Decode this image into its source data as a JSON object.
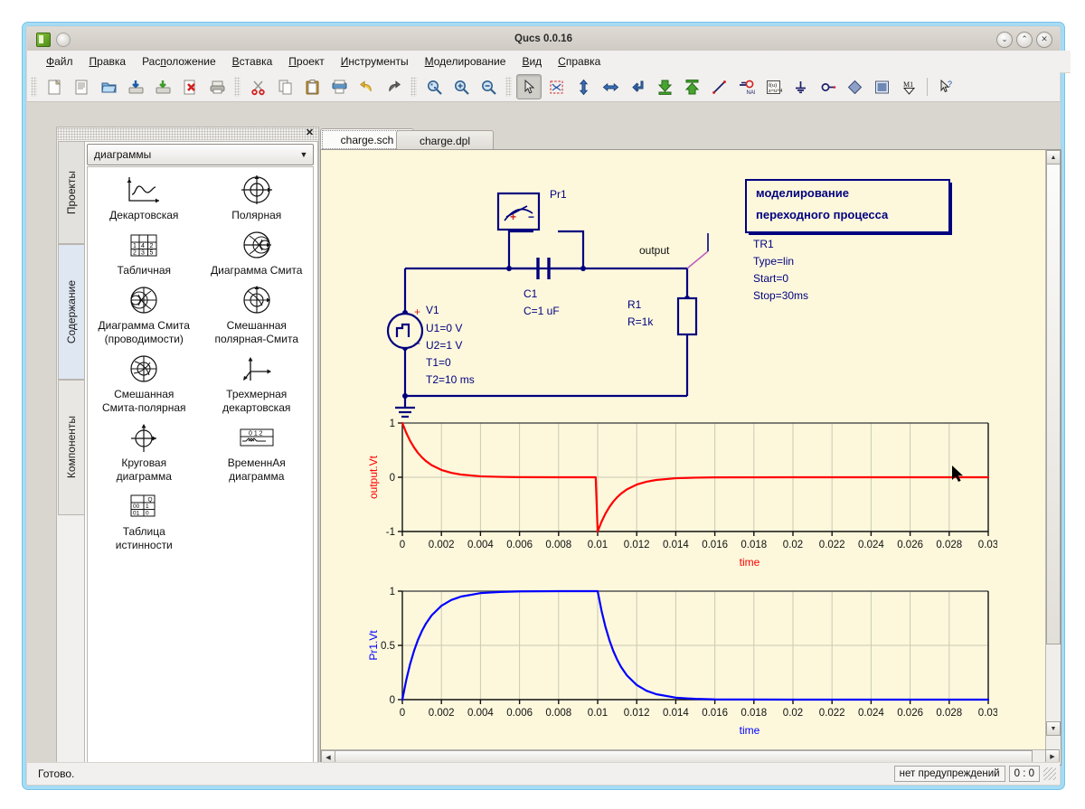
{
  "window": {
    "title": "Qucs 0.0.16",
    "buttons": {
      "minimize": "⌄",
      "maximize": "⌃",
      "close": "✕"
    }
  },
  "menubar": {
    "items": [
      {
        "name": "file",
        "label": "Файл",
        "accel": "Ф"
      },
      {
        "name": "edit",
        "label": "Правка",
        "accel": "П"
      },
      {
        "name": "layout",
        "label": "Расположение",
        "accel": "п"
      },
      {
        "name": "insert",
        "label": "Вставка",
        "accel": "В"
      },
      {
        "name": "project",
        "label": "Проект",
        "accel": "П"
      },
      {
        "name": "tools",
        "label": "Инструменты",
        "accel": "И"
      },
      {
        "name": "simulation",
        "label": "Моделирование",
        "accel": "М"
      },
      {
        "name": "view",
        "label": "Вид",
        "accel": "В"
      },
      {
        "name": "help",
        "label": "Справка",
        "accel": "С"
      }
    ]
  },
  "toolbar": {
    "groups": [
      [
        "new-document-icon",
        "new-text-icon",
        "open-folder-icon",
        "save-icon",
        "save-as-icon",
        "close-document-icon",
        "print-icon"
      ],
      [
        "cut-icon",
        "copy-icon",
        "paste-icon",
        "print-preview-icon",
        "undo-icon",
        "redo-icon"
      ],
      [
        "zoom-fit-icon",
        "zoom-in-icon",
        "zoom-out-icon"
      ],
      [
        "select-pointer-icon",
        "select-all-icon",
        "mirror-vertical-icon",
        "mirror-horizontal-icon",
        "rotate-icon",
        "insert-down-icon",
        "insert-up-icon",
        "wire-icon",
        "wire-label-icon",
        "equation-icon",
        "ground-icon",
        "port-icon",
        "component-icon",
        "marker-icon",
        "simulate-icon"
      ],
      [
        "whats-this-icon"
      ]
    ]
  },
  "dock": {
    "close_label": "✕",
    "vertical_tabs": [
      {
        "name": "projects",
        "label": "Проекты",
        "active": false
      },
      {
        "name": "content",
        "label": "Содержание",
        "active": true
      },
      {
        "name": "components",
        "label": "Компоненты",
        "active": false
      }
    ],
    "combo": {
      "value": "диаграммы",
      "arrow": "▼"
    },
    "items": [
      {
        "name": "cartesian-diagram",
        "label": "Декартовская",
        "icon": "cartesian-icon"
      },
      {
        "name": "polar-diagram",
        "label": "Полярная",
        "icon": "polar-icon"
      },
      {
        "name": "tabular-diagram",
        "label": "Табличная",
        "icon": "table-icon"
      },
      {
        "name": "smith-diagram",
        "label": "Диаграмма Смита",
        "icon": "smith-icon"
      },
      {
        "name": "smith-admittance",
        "label": "Диаграмма Смита (проводимости)",
        "icon": "smith-admit-icon"
      },
      {
        "name": "polar-smith",
        "label": "Смешанная полярная-Смита",
        "icon": "polar-smith-icon"
      },
      {
        "name": "smith-polar",
        "label": "Смешанная Смита-полярная",
        "icon": "smith-polar-icon"
      },
      {
        "name": "3d-cartesian",
        "label": "Трехмерная декартовская",
        "icon": "cartesian3d-icon"
      },
      {
        "name": "round-diagram",
        "label": "Круговая диаграмма",
        "icon": "round-icon"
      },
      {
        "name": "timing-diagram",
        "label": "ВременнАя диаграмма",
        "icon": "timing-icon"
      },
      {
        "name": "truth-table",
        "label": "Таблица истинности",
        "icon": "truthtable-icon"
      }
    ]
  },
  "tabs": [
    {
      "name": "charge-sch",
      "label": "charge.sch",
      "active": true
    },
    {
      "name": "charge-dpl",
      "label": "charge.dpl",
      "active": false
    }
  ],
  "schematic": {
    "probe": {
      "name": "Pr1",
      "plus": "+",
      "minus": "−"
    },
    "capacitor": {
      "name": "C1",
      "value": "C=1 uF"
    },
    "resistor": {
      "name": "R1",
      "value": "R=1k"
    },
    "source": {
      "name": "V1",
      "plus": "+",
      "minus": "−",
      "params": [
        "U1=0 V",
        "U2=1 V",
        "T1=0",
        "T2=10 ms"
      ]
    },
    "wire_label": "output",
    "simulation": {
      "title_line1": "моделирование",
      "title_line2": "переходного процесса",
      "params": [
        "TR1",
        "Type=lin",
        "Start=0",
        "Stop=30ms"
      ]
    }
  },
  "colors": {
    "canvas": "#fdf8dc",
    "schematic_blue": "#00007f",
    "trace_red": "#ff0000",
    "trace_blue": "#0000ff",
    "grid": "#c8c8b4"
  },
  "chart_data": [
    {
      "name": "output-voltage-chart",
      "type": "line",
      "title": "",
      "xlabel": "time",
      "ylabel": "output.Vt",
      "ylabel_color": "#ff0000",
      "xlabel_color": "#ff0000",
      "series_color": "#ff0000",
      "xlim": [
        0,
        0.03
      ],
      "ylim": [
        -1,
        1
      ],
      "xticks": [
        0,
        0.002,
        0.004,
        0.006,
        0.008,
        0.01,
        0.012,
        0.014,
        0.016,
        0.018,
        0.02,
        0.022,
        0.024,
        0.026,
        0.028,
        0.03
      ],
      "xticklabels": [
        "0",
        "0.002",
        "0.004",
        "0.006",
        "0.008",
        "0.01",
        "0.012",
        "0.014",
        "0.016",
        "0.018",
        "0.02",
        "0.022",
        "0.024",
        "0.026",
        "0.028",
        "0.03"
      ],
      "yticks": [
        -1,
        0,
        1
      ],
      "yticklabels": [
        "-1",
        "0",
        "1"
      ],
      "grid": true,
      "description": "Voltage across resistor: step to +1 V at t=0 decaying exponentially (tau=1ms) to 0, then step to -1 V at t=0.01 s recovering exponentially to 0.",
      "x": [
        0,
        0.0002,
        0.0004,
        0.0006,
        0.0008,
        0.001,
        0.0012,
        0.0015,
        0.002,
        0.0025,
        0.003,
        0.004,
        0.005,
        0.006,
        0.008,
        0.0099,
        0.01,
        0.0102,
        0.0104,
        0.0106,
        0.0108,
        0.011,
        0.0112,
        0.0115,
        0.012,
        0.0125,
        0.013,
        0.014,
        0.015,
        0.016,
        0.02,
        0.025,
        0.03
      ],
      "y": [
        1,
        0.819,
        0.67,
        0.549,
        0.449,
        0.368,
        0.301,
        0.223,
        0.135,
        0.082,
        0.05,
        0.018,
        0.007,
        0.002,
        0.0,
        0.0,
        -1,
        -0.819,
        -0.67,
        -0.549,
        -0.449,
        -0.368,
        -0.301,
        -0.223,
        -0.135,
        -0.082,
        -0.05,
        -0.018,
        -0.007,
        -0.002,
        0.0,
        0.0,
        0.0
      ]
    },
    {
      "name": "probe-voltage-chart",
      "type": "line",
      "title": "",
      "xlabel": "time",
      "ylabel": "Pr1.Vt",
      "ylabel_color": "#0000ff",
      "xlabel_color": "#0000ff",
      "series_color": "#0000ff",
      "xlim": [
        0,
        0.03
      ],
      "ylim": [
        0,
        1
      ],
      "xticks": [
        0,
        0.002,
        0.004,
        0.006,
        0.008,
        0.01,
        0.012,
        0.014,
        0.016,
        0.018,
        0.02,
        0.022,
        0.024,
        0.026,
        0.028,
        0.03
      ],
      "xticklabels": [
        "0",
        "0.002",
        "0.004",
        "0.006",
        "0.008",
        "0.01",
        "0.012",
        "0.014",
        "0.016",
        "0.018",
        "0.02",
        "0.022",
        "0.024",
        "0.026",
        "0.028",
        "0.03"
      ],
      "yticks": [
        0,
        0.5,
        1
      ],
      "yticklabels": [
        "0",
        "0.5",
        "1"
      ],
      "grid": true,
      "description": "Capacitor voltage: charges exponentially from 0 to 1 V (tau=1ms) until t=0.01 s, then discharges exponentially back to 0.",
      "x": [
        0,
        0.0002,
        0.0004,
        0.0006,
        0.0008,
        0.001,
        0.0012,
        0.0015,
        0.002,
        0.0025,
        0.003,
        0.004,
        0.005,
        0.006,
        0.008,
        0.0099,
        0.01,
        0.0102,
        0.0104,
        0.0106,
        0.0108,
        0.011,
        0.0112,
        0.0115,
        0.012,
        0.0125,
        0.013,
        0.014,
        0.015,
        0.016,
        0.02,
        0.025,
        0.03
      ],
      "y": [
        0,
        0.181,
        0.33,
        0.451,
        0.551,
        0.632,
        0.699,
        0.777,
        0.865,
        0.918,
        0.95,
        0.982,
        0.993,
        0.998,
        1.0,
        1.0,
        1,
        0.819,
        0.67,
        0.549,
        0.449,
        0.368,
        0.301,
        0.223,
        0.135,
        0.082,
        0.05,
        0.018,
        0.007,
        0.002,
        0.0,
        0.0,
        0.0
      ]
    }
  ],
  "statusbar": {
    "message": "Готово.",
    "warnings": "нет предупреждений",
    "coords": "0 : 0"
  }
}
